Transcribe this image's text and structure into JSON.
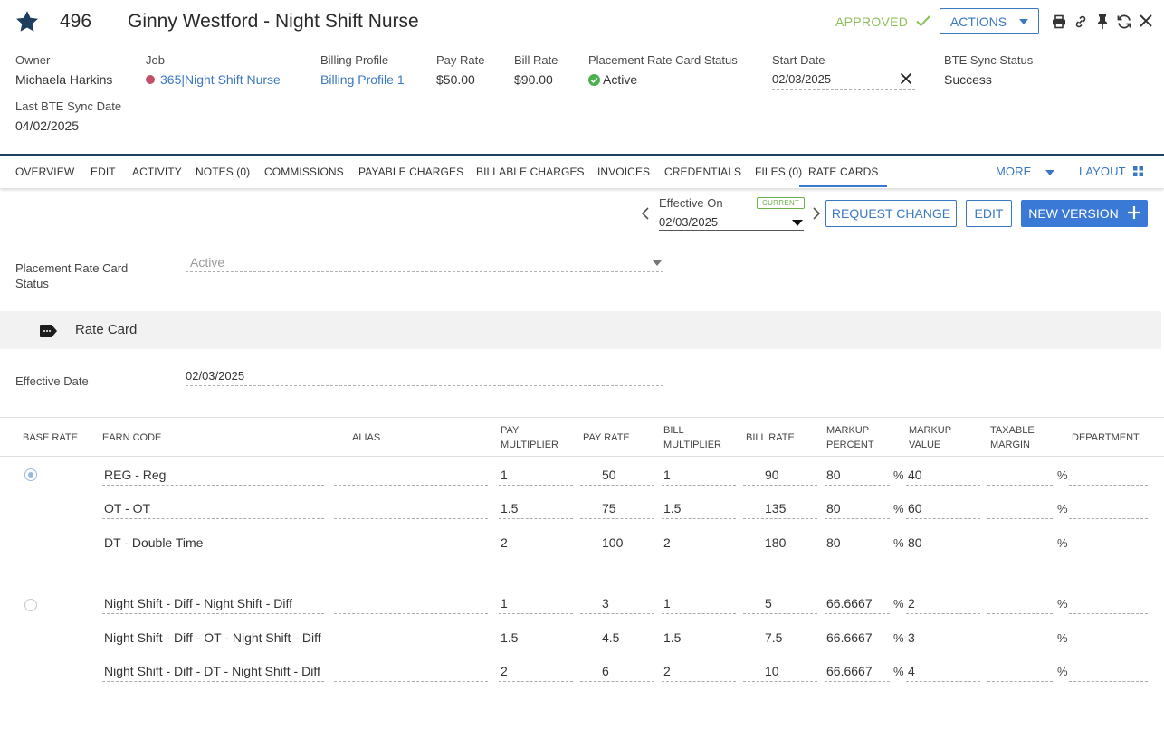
{
  "header": {
    "record_id": "496",
    "title": "Ginny Westford - Night Shift Nurse",
    "status": "APPROVED",
    "actions_label": "ACTIONS"
  },
  "fields": {
    "owner_label": "Owner",
    "owner_value": "Michaela Harkins",
    "job_label": "Job",
    "job_value": "365|Night Shift Nurse",
    "billing_label": "Billing Profile",
    "billing_value": "Billing Profile 1",
    "pay_rate_label": "Pay Rate",
    "pay_rate_value": "$50.00",
    "bill_rate_label": "Bill Rate",
    "bill_rate_value": "$90.00",
    "prc_status_label": "Placement Rate Card Status",
    "prc_status_value": "Active",
    "start_date_label": "Start Date",
    "start_date_value": "02/03/2025",
    "bte_status_label": "BTE Sync Status",
    "bte_status_value": "Success",
    "last_bte_label": "Last BTE Sync Date",
    "last_bte_value": "04/02/2025"
  },
  "tabs": [
    {
      "label": "OVERVIEW"
    },
    {
      "label": "EDIT"
    },
    {
      "label": "ACTIVITY"
    },
    {
      "label": "NOTES (0)"
    },
    {
      "label": "COMMISSIONS"
    },
    {
      "label": "PAYABLE CHARGES"
    },
    {
      "label": "BILLABLE CHARGES"
    },
    {
      "label": "INVOICES"
    },
    {
      "label": "CREDENTIALS"
    },
    {
      "label": "FILES (0)"
    },
    {
      "label": "RATE CARDS"
    }
  ],
  "tabs_more": "MORE",
  "tabs_layout": "LAYOUT",
  "toolbar": {
    "effective_on_label": "Effective On",
    "current_badge": "CURRENT",
    "effective_on_value": "02/03/2025",
    "request_change": "REQUEST CHANGE",
    "edit": "EDIT",
    "new_version": "NEW VERSION"
  },
  "status_field": {
    "label_line1": "Placement Rate Card",
    "label_line2": "Status",
    "value": "Active"
  },
  "rate_card": {
    "section_title": "Rate Card",
    "effective_date_label": "Effective Date",
    "effective_date_value": "02/03/2025"
  },
  "table": {
    "headers": {
      "base_rate": "BASE RATE",
      "earn_code": "EARN CODE",
      "alias": "ALIAS",
      "pay_multiplier_1": "PAY",
      "pay_multiplier_2": "MULTIPLIER",
      "pay_rate": "PAY RATE",
      "bill_multiplier_1": "BILL",
      "bill_multiplier_2": "MULTIPLIER",
      "bill_rate": "BILL RATE",
      "markup_percent_1": "MARKUP",
      "markup_percent_2": "PERCENT",
      "markup_value_1": "MARKUP",
      "markup_value_2": "VALUE",
      "taxable_margin_1": "TAXABLE",
      "taxable_margin_2": "MARGIN",
      "department": "DEPARTMENT"
    },
    "percent_symbol": "%",
    "rows": [
      {
        "earn_code": "REG - Reg",
        "alias": "",
        "pay_mult": "1",
        "pay_rate": "50",
        "bill_mult": "1",
        "bill_rate": "90",
        "markup_pct": "80",
        "markup_val": "40",
        "taxable": "",
        "dept": ""
      },
      {
        "earn_code": "OT - OT",
        "alias": "",
        "pay_mult": "1.5",
        "pay_rate": "75",
        "bill_mult": "1.5",
        "bill_rate": "135",
        "markup_pct": "80",
        "markup_val": "60",
        "taxable": "",
        "dept": ""
      },
      {
        "earn_code": "DT - Double Time",
        "alias": "",
        "pay_mult": "2",
        "pay_rate": "100",
        "bill_mult": "2",
        "bill_rate": "180",
        "markup_pct": "80",
        "markup_val": "80",
        "taxable": "",
        "dept": ""
      },
      {
        "earn_code": "Night Shift - Diff - Night Shift - Diff",
        "alias": "",
        "pay_mult": "1",
        "pay_rate": "3",
        "bill_mult": "1",
        "bill_rate": "5",
        "markup_pct": "66.6667",
        "markup_val": "2",
        "taxable": "",
        "dept": ""
      },
      {
        "earn_code": "Night Shift - Diff - OT - Night Shift - Diff - OT",
        "alias": "",
        "pay_mult": "1.5",
        "pay_rate": "4.5",
        "bill_mult": "1.5",
        "bill_rate": "7.5",
        "markup_pct": "66.6667",
        "markup_val": "3",
        "taxable": "",
        "dept": ""
      },
      {
        "earn_code": "Night Shift - Diff - DT - Night Shift - Diff - DT",
        "alias": "",
        "pay_mult": "2",
        "pay_rate": "6",
        "bill_mult": "2",
        "bill_rate": "10",
        "markup_pct": "66.6667",
        "markup_val": "4",
        "taxable": "",
        "dept": ""
      }
    ]
  },
  "colors": {
    "accent": "#3a7ad6",
    "link": "#3a78c3",
    "approved": "#8dbf5a",
    "header_navy": "#21405e",
    "inactive_dot": "#c0506a"
  }
}
